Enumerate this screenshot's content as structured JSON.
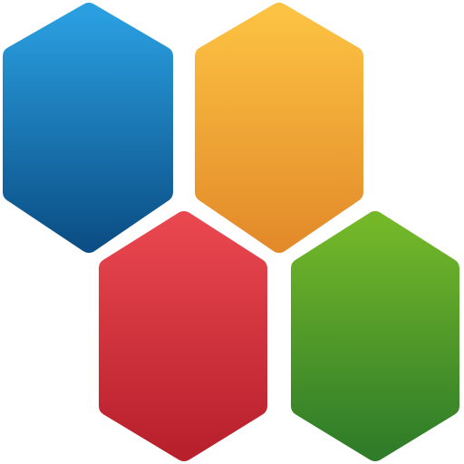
{
  "logo": {
    "name": "four-hexagon-logo",
    "hexagons": [
      {
        "id": "blue",
        "color_top": "#2a9fe0",
        "color_bottom": "#0b4f86"
      },
      {
        "id": "orange",
        "color_top": "#fcc242",
        "color_bottom": "#e38b2a"
      },
      {
        "id": "red",
        "color_top": "#e9474f",
        "color_bottom": "#b8202c"
      },
      {
        "id": "green",
        "color_top": "#74b829",
        "color_bottom": "#2f7c29"
      }
    ]
  }
}
